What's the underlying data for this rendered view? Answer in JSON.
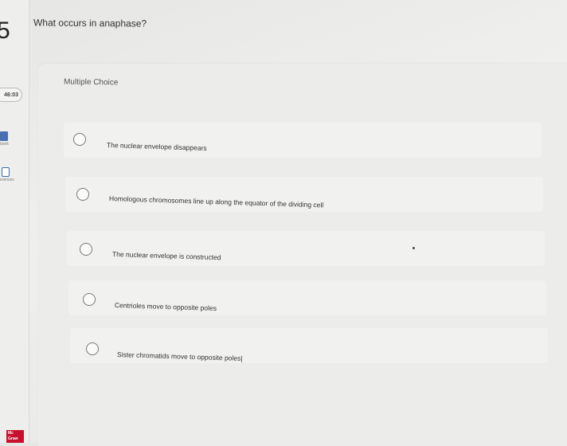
{
  "sidebar": {
    "question_number": "5",
    "timer": "46:03",
    "ebook_label": "book",
    "references_label": "erences"
  },
  "question": {
    "prompt": "What occurs in anaphase?",
    "type_label": "Multiple Choice"
  },
  "choices": [
    {
      "text": "The nuclear envelope disappears"
    },
    {
      "text": "Homologous chromosomes line up along the equator of the dividing cell"
    },
    {
      "text": "The nuclear envelope is constructed"
    },
    {
      "text": "Centrioles move to opposite poles"
    },
    {
      "text": "Sister chromatids move to opposite poles|"
    }
  ],
  "footer": {
    "logo_text": "Mc Graw"
  }
}
